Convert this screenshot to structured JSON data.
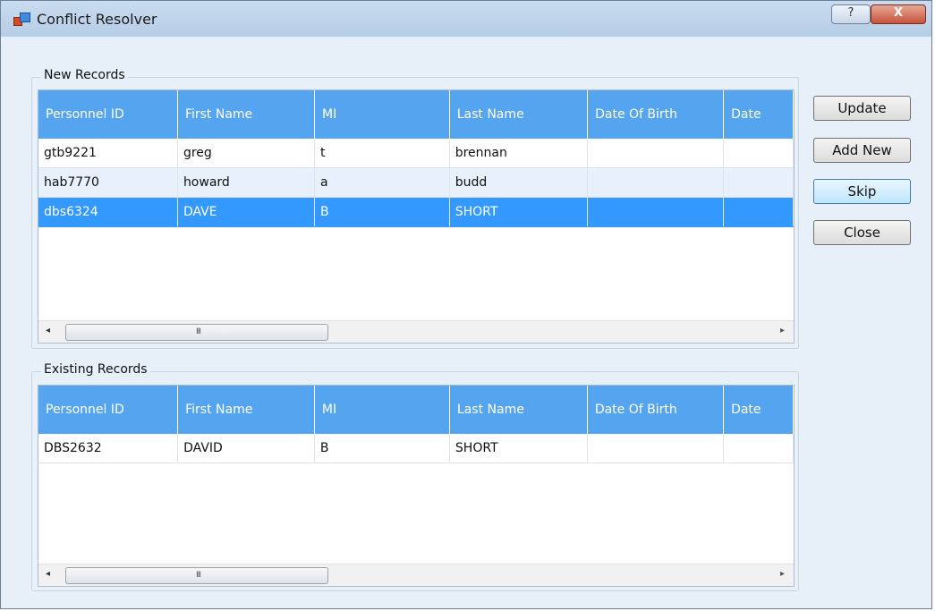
{
  "window": {
    "title": "Conflict Resolver",
    "help_glyph": "?",
    "close_glyph": "X"
  },
  "columns": [
    "Personnel ID",
    "First Name",
    "MI",
    "Last Name",
    "Date Of Birth",
    "Date"
  ],
  "new_records": {
    "label": "New Records",
    "rows": [
      [
        "gtb9221",
        "greg",
        "t",
        "brennan",
        "",
        ""
      ],
      [
        "hab7770",
        "howard",
        "a",
        "budd",
        "",
        ""
      ],
      [
        "dbs6324",
        "DAVE",
        "B",
        "SHORT",
        "",
        ""
      ]
    ],
    "selected_row": 2
  },
  "existing_records": {
    "label": "Existing Records",
    "rows": [
      [
        "DBS2632",
        "DAVID",
        "B",
        "SHORT",
        "",
        ""
      ]
    ]
  },
  "scrollbar": {
    "left_arrow": "◂",
    "right_arrow": "▸",
    "grip": "III"
  },
  "buttons": {
    "update": "Update",
    "add_new": "Add New",
    "skip": "Skip",
    "close": "Close"
  }
}
